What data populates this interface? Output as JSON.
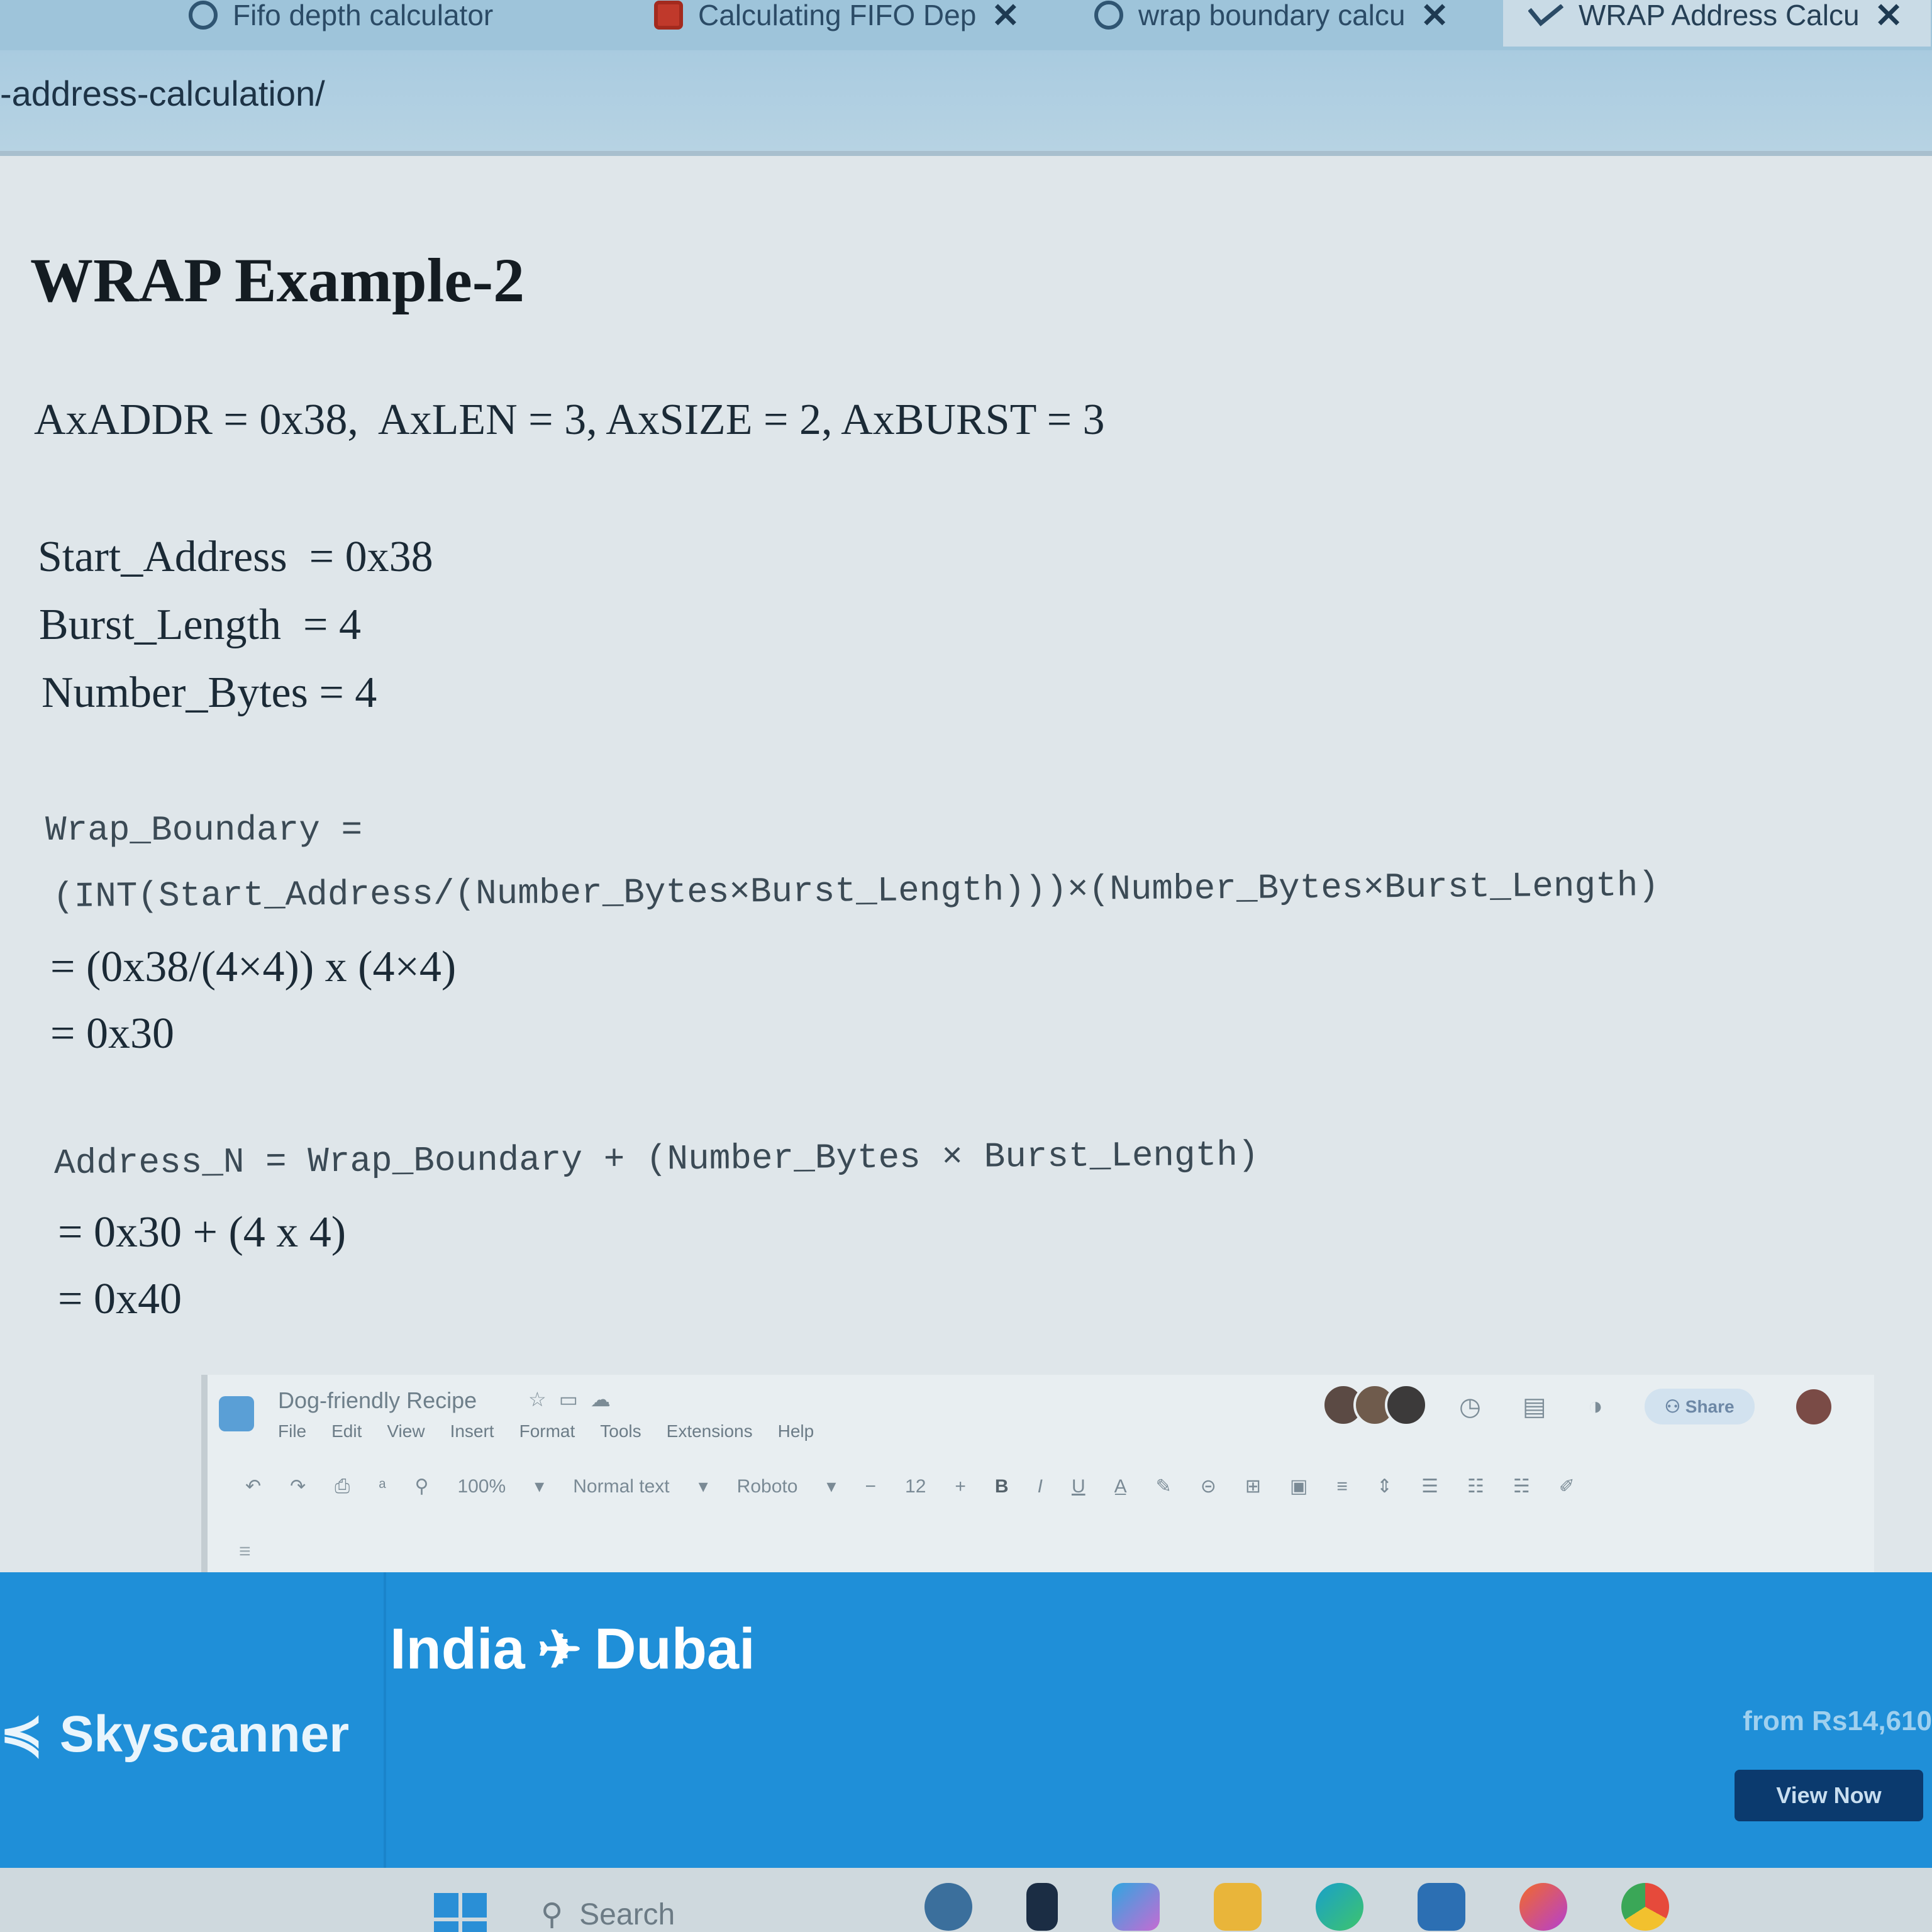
{
  "browser": {
    "tabs": [
      {
        "label": "Fifo depth calculator"
      },
      {
        "label": "Calculating FIFO Dep"
      },
      {
        "label": "wrap boundary calcu"
      },
      {
        "label": "WRAP Address Calcu",
        "active": true
      }
    ],
    "close_glyph": "✕",
    "url": "-address-calculation/"
  },
  "article": {
    "title": "WRAP Example-2",
    "params": "AxADDR = 0x38,  AxLEN = 3, AxSIZE = 2, AxBURST = 3",
    "start_address": "Start_Address  = 0x38",
    "burst_length": "Burst_Length  = 4",
    "number_bytes": "Number_Bytes = 4",
    "wrap_boundary_label": "Wrap_Boundary =",
    "wrap_boundary_formula": "(INT(Start_Address/(Number_Bytes×Burst_Length)))×(Number_Bytes×Burst_Length)",
    "wrap_boundary_step1": "= (0x38/(4×4)) x (4×4)",
    "wrap_boundary_result": "= 0x30",
    "address_n_formula": "Address_N = Wrap_Boundary + (Number_Bytes × Burst_Length)",
    "address_n_step1": "= 0x30 + (4 x 4)",
    "address_n_result": "= 0x40"
  },
  "docs": {
    "doc_title": "Dog-friendly Recipe",
    "menu": [
      "File",
      "Edit",
      "View",
      "Insert",
      "Format",
      "Tools",
      "Extensions",
      "Help"
    ],
    "share_label": "Share",
    "zoom": "100%",
    "style": "Normal text",
    "font": "Roboto",
    "font_size": "12",
    "bold": "B",
    "italic": "I",
    "underline": "U"
  },
  "ad": {
    "origin": "India",
    "destination": "Dubai",
    "brand": "Skyscanner",
    "price": "from Rs14,610",
    "cta": "View Now",
    "colors": {
      "background": "#1f8fd8",
      "cta": "#0b3a6e"
    }
  },
  "taskbar": {
    "search_label": "Search",
    "apps": [
      "fish-app-icon",
      "store-l-icon",
      "copilot-icon",
      "file-explorer-icon",
      "edge-icon",
      "microsoft-store-icon",
      "firefox-icon",
      "chrome-icon"
    ]
  }
}
